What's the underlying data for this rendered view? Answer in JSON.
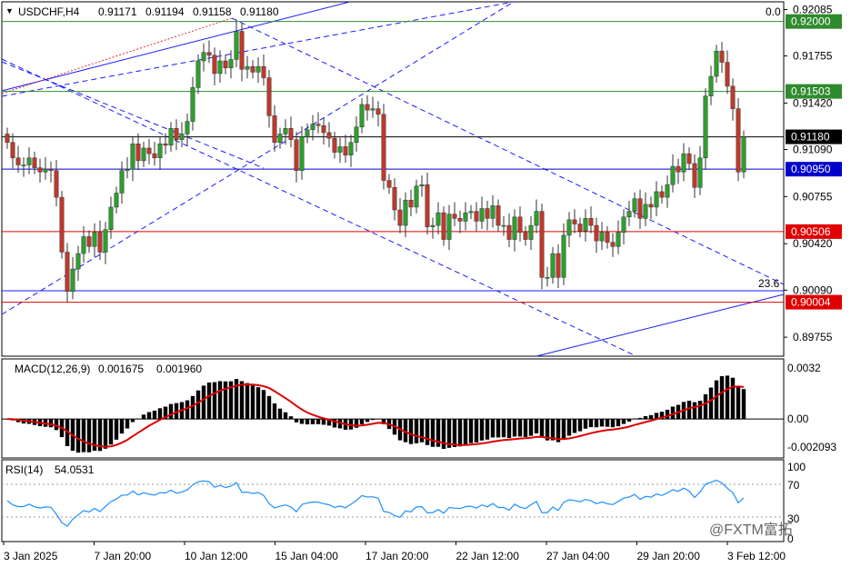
{
  "window": {
    "symbol_header": "USDCHF,H4",
    "ohlc": [
      "0.91171",
      "0.91194",
      "0.91158",
      "0.91180"
    ],
    "fib_top_label": "0.0",
    "fib_label_23": "23.6",
    "watermark": "@FXTM富拓"
  },
  "colors": {
    "bull": "#2ca02c",
    "bear": "#c0392b",
    "support_blue": "#0000cd",
    "resistance_red": "#e00000",
    "level_green": "#2e8b2e",
    "macd_line": "#dd0000",
    "rsi_line": "#1e90ff"
  },
  "chart_data": [
    {
      "type": "candlestick",
      "title": "USDCHF,H4",
      "x_ticks": [
        "3 Jan 2025",
        "7 Jan 20:00",
        "10 Jan 12:00",
        "15 Jan 04:00",
        "17 Jan 20:00",
        "22 Jan 12:00",
        "27 Jan 04:00",
        "29 Jan 20:00",
        "3 Feb 12:00"
      ],
      "y_ticks": [
        "0.92085",
        "0.91755",
        "0.91420",
        "0.91090",
        "0.90755",
        "0.90420",
        "0.90090",
        "0.89755"
      ],
      "ylim": [
        0.8962,
        0.9214
      ],
      "levels": [
        {
          "value": "0.92000",
          "color": "green"
        },
        {
          "value": "0.91503",
          "color": "green"
        },
        {
          "value": "0.91180",
          "color": "black"
        },
        {
          "value": "0.90950",
          "color": "blue"
        },
        {
          "value": "0.90506",
          "color": "red"
        },
        {
          "value": "0.90004",
          "color": "red"
        }
      ],
      "close_series": [
        0.9114,
        0.9103,
        0.9098,
        0.9098,
        0.9103,
        0.9096,
        0.9093,
        0.9095,
        0.9094,
        0.9075,
        0.9036,
        0.9008,
        0.9024,
        0.9035,
        0.9047,
        0.904,
        0.905,
        0.9036,
        0.9052,
        0.9068,
        0.9078,
        0.9094,
        0.9095,
        0.9113,
        0.9101,
        0.911,
        0.9106,
        0.9103,
        0.9113,
        0.9112,
        0.9124,
        0.9116,
        0.912,
        0.9129,
        0.9153,
        0.9172,
        0.9178,
        0.9176,
        0.9163,
        0.9172,
        0.9167,
        0.9173,
        0.9193,
        0.9166,
        0.9168,
        0.9164,
        0.9168,
        0.916,
        0.9133,
        0.9114,
        0.912,
        0.9124,
        0.9116,
        0.9094,
        0.9118,
        0.9123,
        0.9127,
        0.9126,
        0.9121,
        0.9117,
        0.9107,
        0.9111,
        0.9105,
        0.9114,
        0.9125,
        0.9141,
        0.9137,
        0.9138,
        0.9134,
        0.9087,
        0.9082,
        0.9066,
        0.9055,
        0.9073,
        0.9068,
        0.9083,
        0.9084,
        0.9054,
        0.9055,
        0.9064,
        0.9045,
        0.9063,
        0.906,
        0.9058,
        0.9064,
        0.9065,
        0.9058,
        0.9067,
        0.906,
        0.9069,
        0.9055,
        0.9055,
        0.9045,
        0.9061,
        0.905,
        0.9045,
        0.9055,
        0.9065,
        0.9018,
        0.9018,
        0.9035,
        0.9018,
        0.9048,
        0.9059,
        0.9056,
        0.9051,
        0.906,
        0.9055,
        0.9044,
        0.905,
        0.9043,
        0.904,
        0.905,
        0.9061,
        0.9065,
        0.9074,
        0.906,
        0.907,
        0.9068,
        0.9079,
        0.9075,
        0.9084,
        0.9097,
        0.9093,
        0.9106,
        0.9099,
        0.9082,
        0.9103,
        0.9147,
        0.9161,
        0.9179,
        0.9171,
        0.9154,
        0.9138,
        0.9093,
        0.9118
      ],
      "subpanels": [
        {
          "name": "MACD(12,26,9)",
          "values": [
            "0.001675",
            "0.001960"
          ],
          "y_ticks": [
            "0.0032",
            "0.00",
            "-0.002093"
          ],
          "ylim": [
            -0.0024,
            0.0037
          ]
        },
        {
          "name": "RSI(14)",
          "values": [
            "54.0531"
          ],
          "y_ticks": [
            "100",
            "70",
            "30",
            "0"
          ],
          "ylim": [
            0,
            100
          ]
        }
      ]
    }
  ]
}
